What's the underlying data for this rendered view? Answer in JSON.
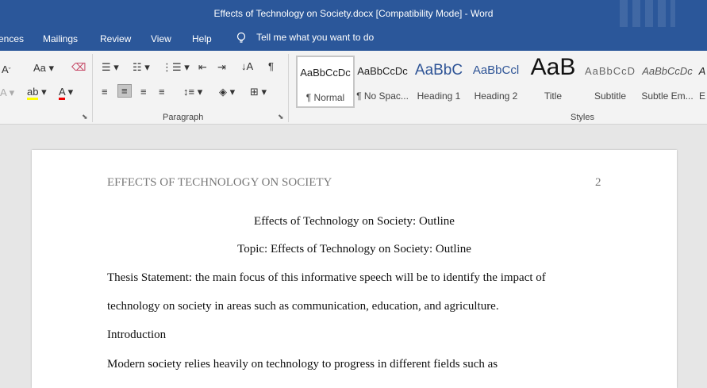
{
  "window": {
    "title": "Effects of Technology on Society.docx [Compatibility Mode]  -  Word"
  },
  "tabs": [
    "ences",
    "Mailings",
    "Review",
    "View",
    "Help"
  ],
  "tell_me": "Tell me what you want to do",
  "ribbon": {
    "paragraph_label": "Paragraph",
    "styles_label": "Styles",
    "styles": [
      {
        "sample": "AaBbCcDc",
        "label": "¶ Normal"
      },
      {
        "sample": "AaBbCcDc",
        "label": "¶ No Spac..."
      },
      {
        "sample": "AaBbC",
        "label": "Heading 1"
      },
      {
        "sample": "AaBbCcl",
        "label": "Heading 2"
      },
      {
        "sample": "AaB",
        "label": "Title"
      },
      {
        "sample": "AaBbCcD",
        "label": "Subtitle"
      },
      {
        "sample": "AaBbCcDc",
        "label": "Subtle Em..."
      },
      {
        "sample": "A",
        "label": "E"
      }
    ]
  },
  "document": {
    "header": "EFFECTS OF TECHNOLOGY ON SOCIETY",
    "page_number": "2",
    "title": "Effects of Technology on Society: Outline",
    "topic": "Topic: Effects of Technology on Society: Outline",
    "thesis_line1": "Thesis Statement: the main focus of this informative speech will be to identify the impact of",
    "thesis_line2": "technology on society in areas such as communication, education, and agriculture.",
    "introduction": "Introduction",
    "body_line1": "Modern society relies heavily on technology to progress in different fields such as"
  }
}
